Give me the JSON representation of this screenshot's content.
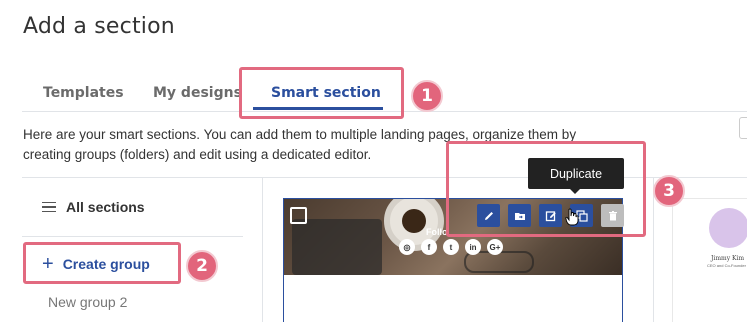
{
  "page": {
    "title": "Add a section"
  },
  "tabs": [
    {
      "label": "Templates",
      "active": false
    },
    {
      "label": "My designs",
      "active": false
    },
    {
      "label": "Smart section",
      "active": true
    }
  ],
  "description": "Here are your smart sections. You can add them to multiple landing pages, organize them by creating groups (folders) and edit using a dedicated editor.",
  "sidebar": {
    "all_sections_label": "All sections",
    "create_group_label": "Create group",
    "groups": [
      "New group 2"
    ]
  },
  "card": {
    "follow_text": "Follo",
    "socials": [
      "instagram-icon",
      "facebook-icon",
      "twitter-icon",
      "linkedin-icon",
      "googleplus-icon"
    ],
    "social_glyphs": [
      "◎",
      "f",
      "t",
      "in",
      "G+"
    ],
    "tools": [
      "edit-icon",
      "move-to-folder-icon",
      "edit-in-editor-icon",
      "duplicate-icon",
      "delete-icon"
    ],
    "tooltip": "Duplicate"
  },
  "preview2": {
    "name": "Jimmy Kim",
    "role": "CEO and Co-Founder"
  },
  "annotations": [
    "1",
    "2",
    "3"
  ],
  "colors": {
    "accent": "#2b4f9e",
    "highlight": "#e26a80",
    "badge": "#e2657c"
  }
}
